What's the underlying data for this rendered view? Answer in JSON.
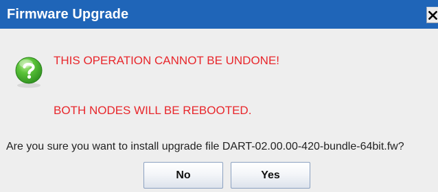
{
  "dialog": {
    "title": "Firmware Upgrade",
    "close_icon": "close-icon",
    "status_icon": "question-icon",
    "warnings": [
      "THIS OPERATION CANNOT BE UNDONE!",
      "BOTH NODES WILL BE REBOOTED."
    ],
    "message": "Are you sure you want to install upgrade file DART-02.00.00-420-bundle-64bit.fw?",
    "buttons": {
      "no_label": "No",
      "yes_label": "Yes"
    }
  },
  "colors": {
    "titlebar": "#1f65b8",
    "warning_text": "#e8262b",
    "icon_green": "#3fae2a",
    "background": "#eeeeee"
  }
}
